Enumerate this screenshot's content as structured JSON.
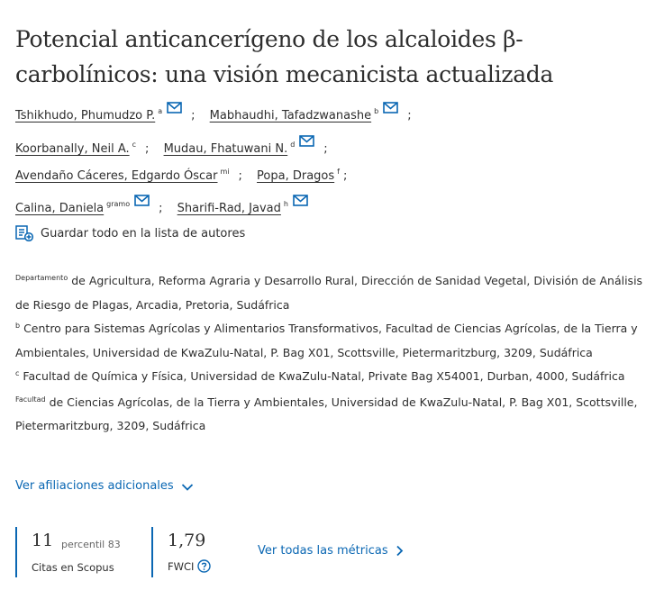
{
  "article": {
    "title": "Potencial anticancerígeno de los alcaloides β-carbolínicos: una visión mecanicista actualizada"
  },
  "authors": [
    {
      "name": "Tshikhudo, Phumudzo P.",
      "sup": "a",
      "email": true
    },
    {
      "name": "Mabhaudhi, Tafadzwanashe",
      "sup": "b",
      "email": true
    },
    {
      "name": "Koorbanally, Neil A.",
      "sup": "c",
      "email": false
    },
    {
      "name": "Mudau, Fhatuwani N.",
      "sup": "d",
      "email": true
    },
    {
      "name": "Avendaño Cáceres, Edgardo Óscar",
      "sup": "mi",
      "email": false
    },
    {
      "name": "Popa, Dragos",
      "sup": "f",
      "email": false
    },
    {
      "name": "Calina, Daniela",
      "sup": "gramo",
      "email": true
    },
    {
      "name": "Sharifi-Rad, Javad",
      "sup": "h",
      "email": true
    }
  ],
  "separator": ";",
  "save_all_label": "Guardar todo en la lista de autores",
  "affiliations": [
    {
      "sup": "Departamento",
      "text": "de Agricultura, Reforma Agraria y Desarrollo Rural, Dirección de Sanidad Vegetal, División de Análisis de Riesgo de Plagas, Arcadia, Pretoria, Sudáfrica"
    },
    {
      "sup": "b",
      "text": "Centro para Sistemas Agrícolas y Alimentarios Transformativos, Facultad de Ciencias Agrícolas, de la Tierra y Ambientales, Universidad de KwaZulu-Natal, P. Bag X01, Scottsville, Pietermaritzburg, 3209, Sudáfrica"
    },
    {
      "sup": "c",
      "text": "Facultad de Química y Física, Universidad de KwaZulu-Natal, Private Bag X54001, Durban, 4000, Sudáfrica"
    },
    {
      "sup": "Facultad",
      "text": "de Ciencias Agrícolas, de la Tierra y Ambientales, Universidad de KwaZulu-Natal, P. Bag X01, Scottsville, Pietermaritzburg, 3209, Sudáfrica"
    }
  ],
  "more_affiliations_label": "Ver afiliaciones adicionales",
  "metrics": {
    "citations_value": "11",
    "citations_percentile": "percentil 83",
    "citations_label": "Citas en Scopus",
    "fwci_value": "1,79",
    "fwci_label": "FWCI",
    "view_all_label": "Ver todas las métricas"
  },
  "colors": {
    "accent": "#0a67b3",
    "text": "#2e2e2e"
  },
  "icons": {
    "email": "envelope-icon",
    "save": "save-list-icon",
    "help": "help-circle-icon",
    "chevron_down": "chevron-down-icon",
    "chevron_right": "chevron-right-icon"
  }
}
